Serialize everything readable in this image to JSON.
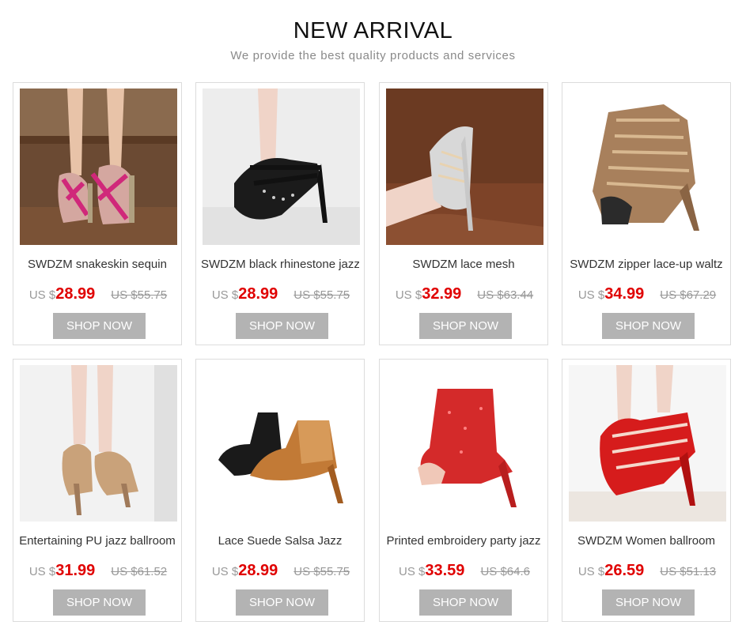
{
  "header": {
    "title": "NEW ARRIVAL",
    "subtitle": "We provide the best quality products and services"
  },
  "currency_label": "US $",
  "products": [
    {
      "name": "SWDZM snakeskin sequin",
      "price": "28.99",
      "old_price": "US $55.75",
      "button": "SHOP NOW",
      "image": "pink snakeskin strappy dance sandal"
    },
    {
      "name": "SWDZM black rhinestone jazz",
      "price": "28.99",
      "old_price": "US $55.75",
      "button": "SHOP NOW",
      "image": "black rhinestone mesh heel"
    },
    {
      "name": "SWDZM lace mesh",
      "price": "32.99",
      "old_price": "US $63.44",
      "button": "SHOP NOW",
      "image": "silver glitter lace-up boot"
    },
    {
      "name": "SWDZM zipper lace-up waltz",
      "price": "34.99",
      "old_price": "US $67.29",
      "button": "SHOP NOW",
      "image": "bronze lace-up bootie"
    },
    {
      "name": "Entertaining PU jazz ballroom",
      "price": "31.99",
      "old_price": "US $61.52",
      "button": "SHOP NOW",
      "image": "gold snakeskin ankle heel"
    },
    {
      "name": "Lace Suede Salsa Jazz",
      "price": "28.99",
      "old_price": "US $55.75",
      "button": "SHOP NOW",
      "image": "black and tan lace suede heels"
    },
    {
      "name": "Printed embroidery party jazz",
      "price": "33.59",
      "old_price": "US $64.6",
      "button": "SHOP NOW",
      "image": "red glitter ankle boot"
    },
    {
      "name": "SWDZM Women ballroom",
      "price": "26.59",
      "old_price": "US $51.13",
      "button": "SHOP NOW",
      "image": "red suede lace-up heel"
    }
  ]
}
